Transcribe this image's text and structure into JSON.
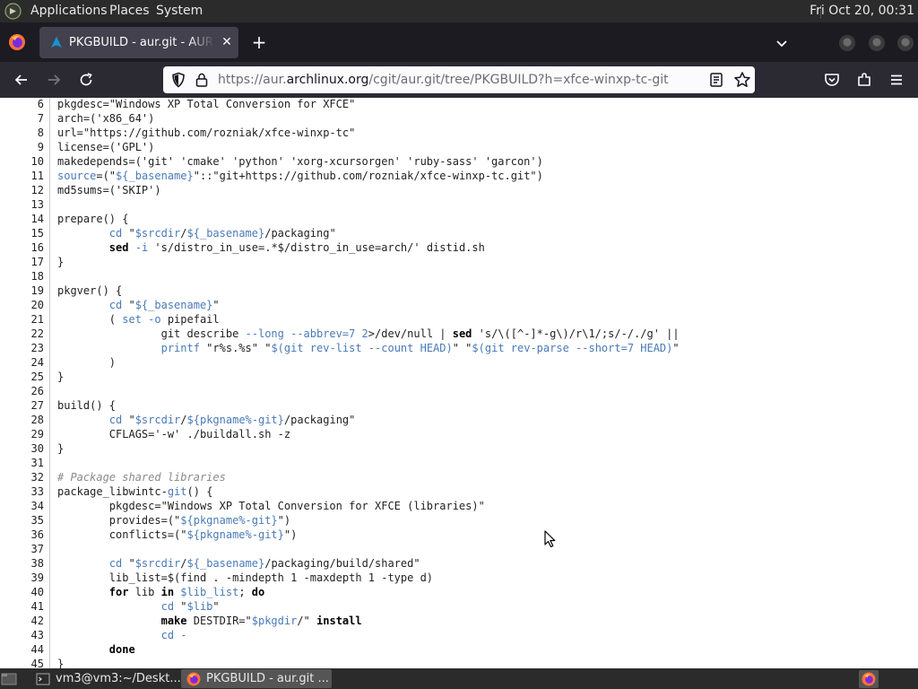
{
  "panel": {
    "menus": [
      "Applications",
      "Places",
      "System"
    ],
    "clock": "Fri Oct 20, 00:31"
  },
  "browser": {
    "tab_title": "PKGBUILD - aur.git - AUR Package Repositories",
    "url_prefix": "https://aur.",
    "url_host": "archlinux.org",
    "url_path": "/cgit/aur.git/tree/PKGBUILD?h=xfce-winxp-tc-git"
  },
  "code": {
    "lines": [
      {
        "n": "6",
        "html": "pkgdesc=\"Windows XP Total Conversion for XFCE\""
      },
      {
        "n": "7",
        "html": "arch=('x86_64')"
      },
      {
        "n": "8",
        "html": "url=\"https://github.com/rozniak/xfce-winxp-tc\""
      },
      {
        "n": "9",
        "html": "license=('GPL')"
      },
      {
        "n": "10",
        "html": "makedepends=('git' 'cmake' 'python' 'xorg-xcursorgen' 'ruby-sass' 'garcon')"
      },
      {
        "n": "11",
        "html": "<span class=\"var\">source</span>=(\"<span class=\"var\">${_basename}</span>\"::\"git+https://github.com/rozniak/xfce-winxp-tc.git\")"
      },
      {
        "n": "12",
        "html": "md5sums=('SKIP')"
      },
      {
        "n": "13",
        "html": ""
      },
      {
        "n": "14",
        "html": "prepare() {"
      },
      {
        "n": "15",
        "html": "        <span class=\"var\">cd</span> \"<span class=\"var\">$srcdir</span>/<span class=\"var\">${_basename}</span>/packaging\""
      },
      {
        "n": "16",
        "html": "        <span class=\"kw\">sed</span> <span class=\"var\">-i</span> 's/distro_in_use=.*$/distro_in_use=arch/' distid.sh"
      },
      {
        "n": "17",
        "html": "}"
      },
      {
        "n": "18",
        "html": ""
      },
      {
        "n": "19",
        "html": "pkgver() {"
      },
      {
        "n": "20",
        "html": "        <span class=\"var\">cd</span> \"<span class=\"var\">${_basename}</span>\""
      },
      {
        "n": "21",
        "html": "        ( <span class=\"var\">set -o</span> pipefail"
      },
      {
        "n": "22",
        "html": "                git describe <span class=\"var\">--long --abbrev=7 2</span>&gt;/dev/null | <span class=\"kw\">sed</span> 's/\\([^-]*-g\\)/r\\1/;s/-/./g' ||"
      },
      {
        "n": "23",
        "html": "                <span class=\"var\">printf</span> \"r%s.%s\" \"<span class=\"var\">$(git rev-list --count HEAD)</span>\" \"<span class=\"var\">$(git rev-parse --short=7 HEAD)</span>\""
      },
      {
        "n": "24",
        "html": "        )"
      },
      {
        "n": "25",
        "html": "}"
      },
      {
        "n": "26",
        "html": ""
      },
      {
        "n": "27",
        "html": "build() {"
      },
      {
        "n": "28",
        "html": "        <span class=\"var\">cd</span> \"<span class=\"var\">$srcdir</span>/<span class=\"var\">${pkgname%-git}</span>/packaging\""
      },
      {
        "n": "29",
        "html": "        CFLAGS='-w' ./buildall.sh -z"
      },
      {
        "n": "30",
        "html": "}"
      },
      {
        "n": "31",
        "html": ""
      },
      {
        "n": "32",
        "html": "<span class=\"cm\"># Package shared libraries</span>"
      },
      {
        "n": "33",
        "html": "package_libwintc-<span class=\"var\">git</span>() {"
      },
      {
        "n": "34",
        "html": "        pkgdesc=\"Windows XP Total Conversion for XFCE (libraries)\""
      },
      {
        "n": "35",
        "html": "        provides=(\"<span class=\"var\">${pkgname%-git}</span>\")"
      },
      {
        "n": "36",
        "html": "        conflicts=(\"<span class=\"var\">${pkgname%-git}</span>\")"
      },
      {
        "n": "37",
        "html": ""
      },
      {
        "n": "38",
        "html": "        <span class=\"var\">cd</span> \"<span class=\"var\">$srcdir</span>/<span class=\"var\">${_basename}</span>/packaging/build/shared\""
      },
      {
        "n": "39",
        "html": "        lib_list=$(find . -mindepth 1 -maxdepth 1 -type d)"
      },
      {
        "n": "40",
        "html": "        <span class=\"kw\">for</span> lib <span class=\"kw\">in</span> <span class=\"var\">$lib_list</span>; <span class=\"kw\">do</span>"
      },
      {
        "n": "41",
        "html": "                <span class=\"var\">cd</span> \"<span class=\"var\">$lib</span>\""
      },
      {
        "n": "42",
        "html": "                <span class=\"kw\">make</span> DESTDIR=\"<span class=\"var\">$pkgdir</span>/\" <span class=\"kw\">install</span>"
      },
      {
        "n": "43",
        "html": "                <span class=\"var\">cd -</span>"
      },
      {
        "n": "44",
        "html": "        <span class=\"kw\">done</span>"
      },
      {
        "n": "45",
        "html": "}"
      }
    ]
  },
  "taskbar": {
    "tasks": [
      {
        "label": "vm3@vm3:~/Deskt..."
      },
      {
        "label": "PKGBUILD - aur.git ..."
      }
    ]
  }
}
